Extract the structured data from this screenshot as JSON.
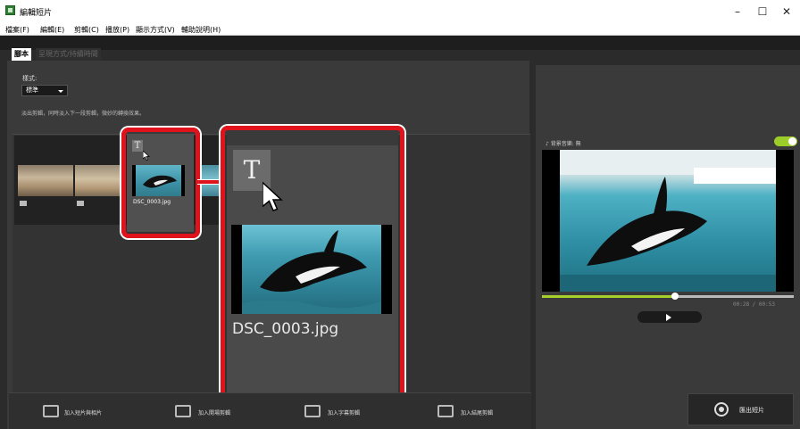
{
  "window": {
    "title": "編輯短片",
    "minimize": "–",
    "maximize": "☐",
    "close": "✕"
  },
  "menu": [
    "檔案(F)",
    "編輯(E)",
    "剪輯(C)",
    "播放(P)",
    "顯示方式(V)",
    "輔助說明(H)"
  ],
  "tabs": {
    "script": "腳本",
    "presentation": "呈現方式/持續時間"
  },
  "mode": {
    "label": "樣式:",
    "value": "標準",
    "description": "淡出剪輯，同時淡入下一段剪輯，微妙的轉換效果。"
  },
  "clip": {
    "filename": "DSC_0003.jpg",
    "title_marker": "T"
  },
  "bottom_buttons": {
    "add_clips": "加入短片與相片",
    "add_opening": "加入開場剪輯",
    "add_caption": "加入字幕剪輯",
    "add_ending": "加入結尾剪輯"
  },
  "preview": {
    "music_label": "♪ 背景音樂: 無",
    "time": "00:28 / 00:53",
    "progress_fraction": 0.53,
    "export_label": "匯出短片"
  },
  "colors": {
    "highlight": "#e0121b",
    "accent": "#a8d02b"
  }
}
